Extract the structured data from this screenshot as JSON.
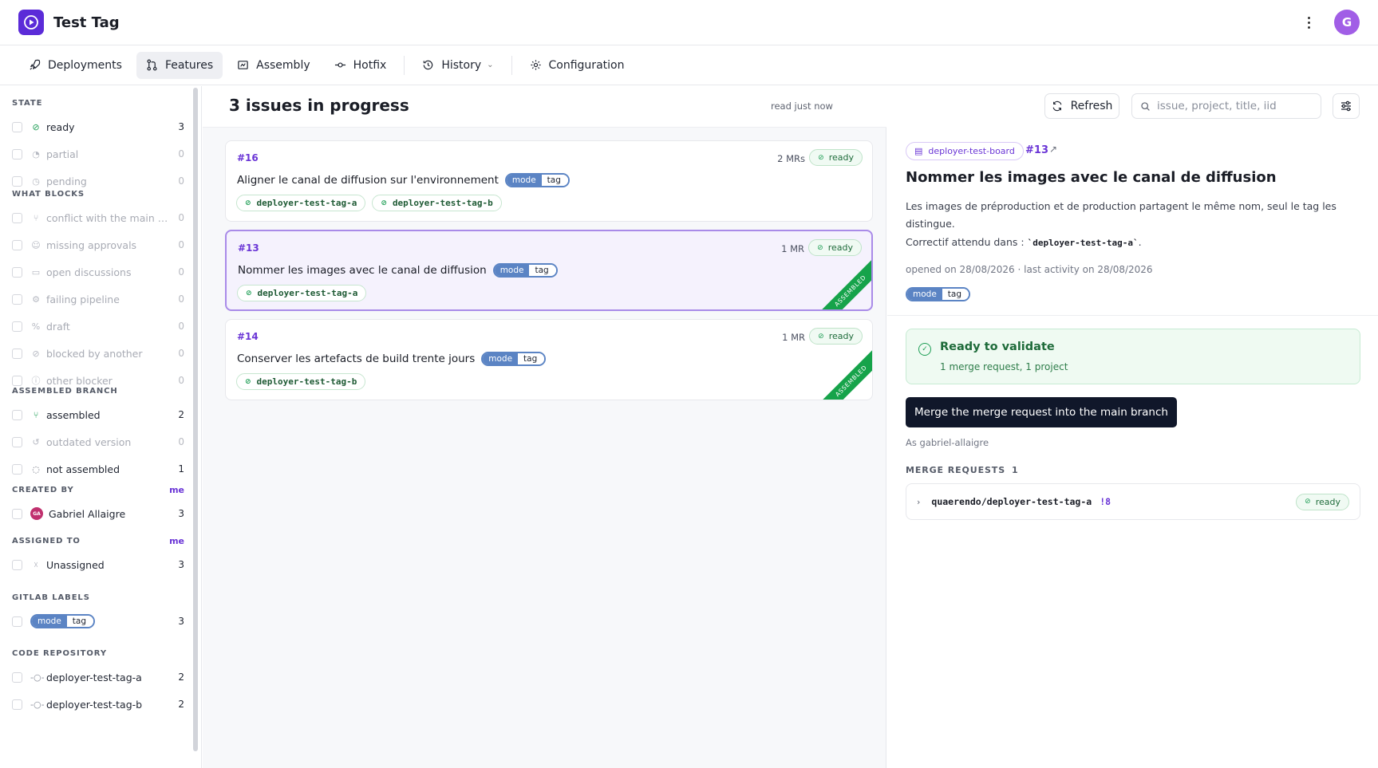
{
  "app": {
    "title": "Test Tag",
    "avatar_initial": "G"
  },
  "nav": {
    "items": [
      {
        "label": "Deployments",
        "icon": "rocket-icon"
      },
      {
        "label": "Features",
        "icon": "merge-request-icon",
        "active": true
      },
      {
        "label": "Assembly",
        "icon": "assembly-icon"
      },
      {
        "label": "Hotfix",
        "icon": "commit-icon"
      },
      {
        "label": "History",
        "icon": "history-icon"
      },
      {
        "label": "Configuration",
        "icon": "gear-icon"
      }
    ]
  },
  "sidebar": {
    "state": {
      "title": "STATE",
      "items": [
        {
          "label": "ready",
          "count": "3"
        },
        {
          "label": "partial",
          "count": "0"
        },
        {
          "label": "pending",
          "count": "0"
        }
      ]
    },
    "what_blocks": {
      "title": "WHAT BLOCKS",
      "items": [
        {
          "label": "conflict with the main b...",
          "count": "0"
        },
        {
          "label": "missing approvals",
          "count": "0"
        },
        {
          "label": "open discussions",
          "count": "0"
        },
        {
          "label": "failing pipeline",
          "count": "0"
        },
        {
          "label": "draft",
          "count": "0"
        },
        {
          "label": "blocked by another",
          "count": "0"
        },
        {
          "label": "other blocker",
          "count": "0"
        }
      ]
    },
    "assembled_branch": {
      "title": "ASSEMBLED BRANCH",
      "items": [
        {
          "label": "assembled",
          "count": "2"
        },
        {
          "label": "outdated version",
          "count": "0"
        },
        {
          "label": "not assembled",
          "count": "1"
        }
      ]
    },
    "created_by": {
      "title": "CREATED BY",
      "me": "me",
      "items": [
        {
          "label": "Gabriel Allaigre",
          "initials": "GA",
          "count": "3"
        }
      ]
    },
    "assigned_to": {
      "title": "ASSIGNED TO",
      "me": "me",
      "items": [
        {
          "label": "Unassigned",
          "count": "3"
        }
      ]
    },
    "gitlab_labels": {
      "title": "GITLAB LABELS",
      "items": [
        {
          "key": "mode",
          "value": "tag",
          "count": "3"
        }
      ]
    },
    "code_repository": {
      "title": "CODE REPOSITORY",
      "items": [
        {
          "label": "deployer-test-tag-a",
          "count": "2"
        },
        {
          "label": "deployer-test-tag-b",
          "count": "2"
        }
      ]
    }
  },
  "main": {
    "title": "3 issues in progress",
    "read_time": "read just now",
    "refresh_label": "Refresh",
    "search_placeholder": "issue, project, title, iid",
    "issues": [
      {
        "id": "#16",
        "mrs": "2 MRs",
        "status": "ready",
        "title": "Aligner le canal de diffusion sur l'environnement",
        "label_key": "mode",
        "label_value": "tag",
        "repos": [
          "deployer-test-tag-a",
          "deployer-test-tag-b"
        ]
      },
      {
        "id": "#13",
        "mrs": "1 MR",
        "status": "ready",
        "title": "Nommer les images avec le canal de diffusion",
        "label_key": "mode",
        "label_value": "tag",
        "repos": [
          "deployer-test-tag-a"
        ],
        "ribbon": "ASSEMBLED"
      },
      {
        "id": "#14",
        "mrs": "1 MR",
        "status": "ready",
        "title": "Conserver les artefacts de build trente jours",
        "label_key": "mode",
        "label_value": "tag",
        "repos": [
          "deployer-test-tag-b"
        ],
        "ribbon": "ASSEMBLED"
      }
    ]
  },
  "detail": {
    "board": "deployer-test-board",
    "id": "#13",
    "title": "Nommer les images avec le canal de diffusion",
    "description": "Les images de préproduction et de production partagent le même nom, seul le tag les distingue.",
    "fix_prefix": "Correctif attendu dans : ",
    "fix_code": "`deployer-test-tag-a`",
    "fix_suffix": ".",
    "meta": "opened on 28/08/2026 · last activity on 28/08/2026",
    "label_key": "mode",
    "label_value": "tag",
    "ready_title": "Ready to validate",
    "ready_sub": "1 merge request, 1 project",
    "merge_button": "Merge the merge request into the main branch",
    "as_user": "As gabriel-allaigre",
    "mr_section": "MERGE REQUESTS",
    "mr_count": "1",
    "mr": {
      "path": "quaerendo/deployer-test-tag-a",
      "number": "!8",
      "status": "ready"
    }
  },
  "colors": {
    "accent": "#6a35d6",
    "ready_green": "#1e9e55",
    "label_blue": "#5b84c4",
    "ribbon_green": "#16a34a"
  }
}
